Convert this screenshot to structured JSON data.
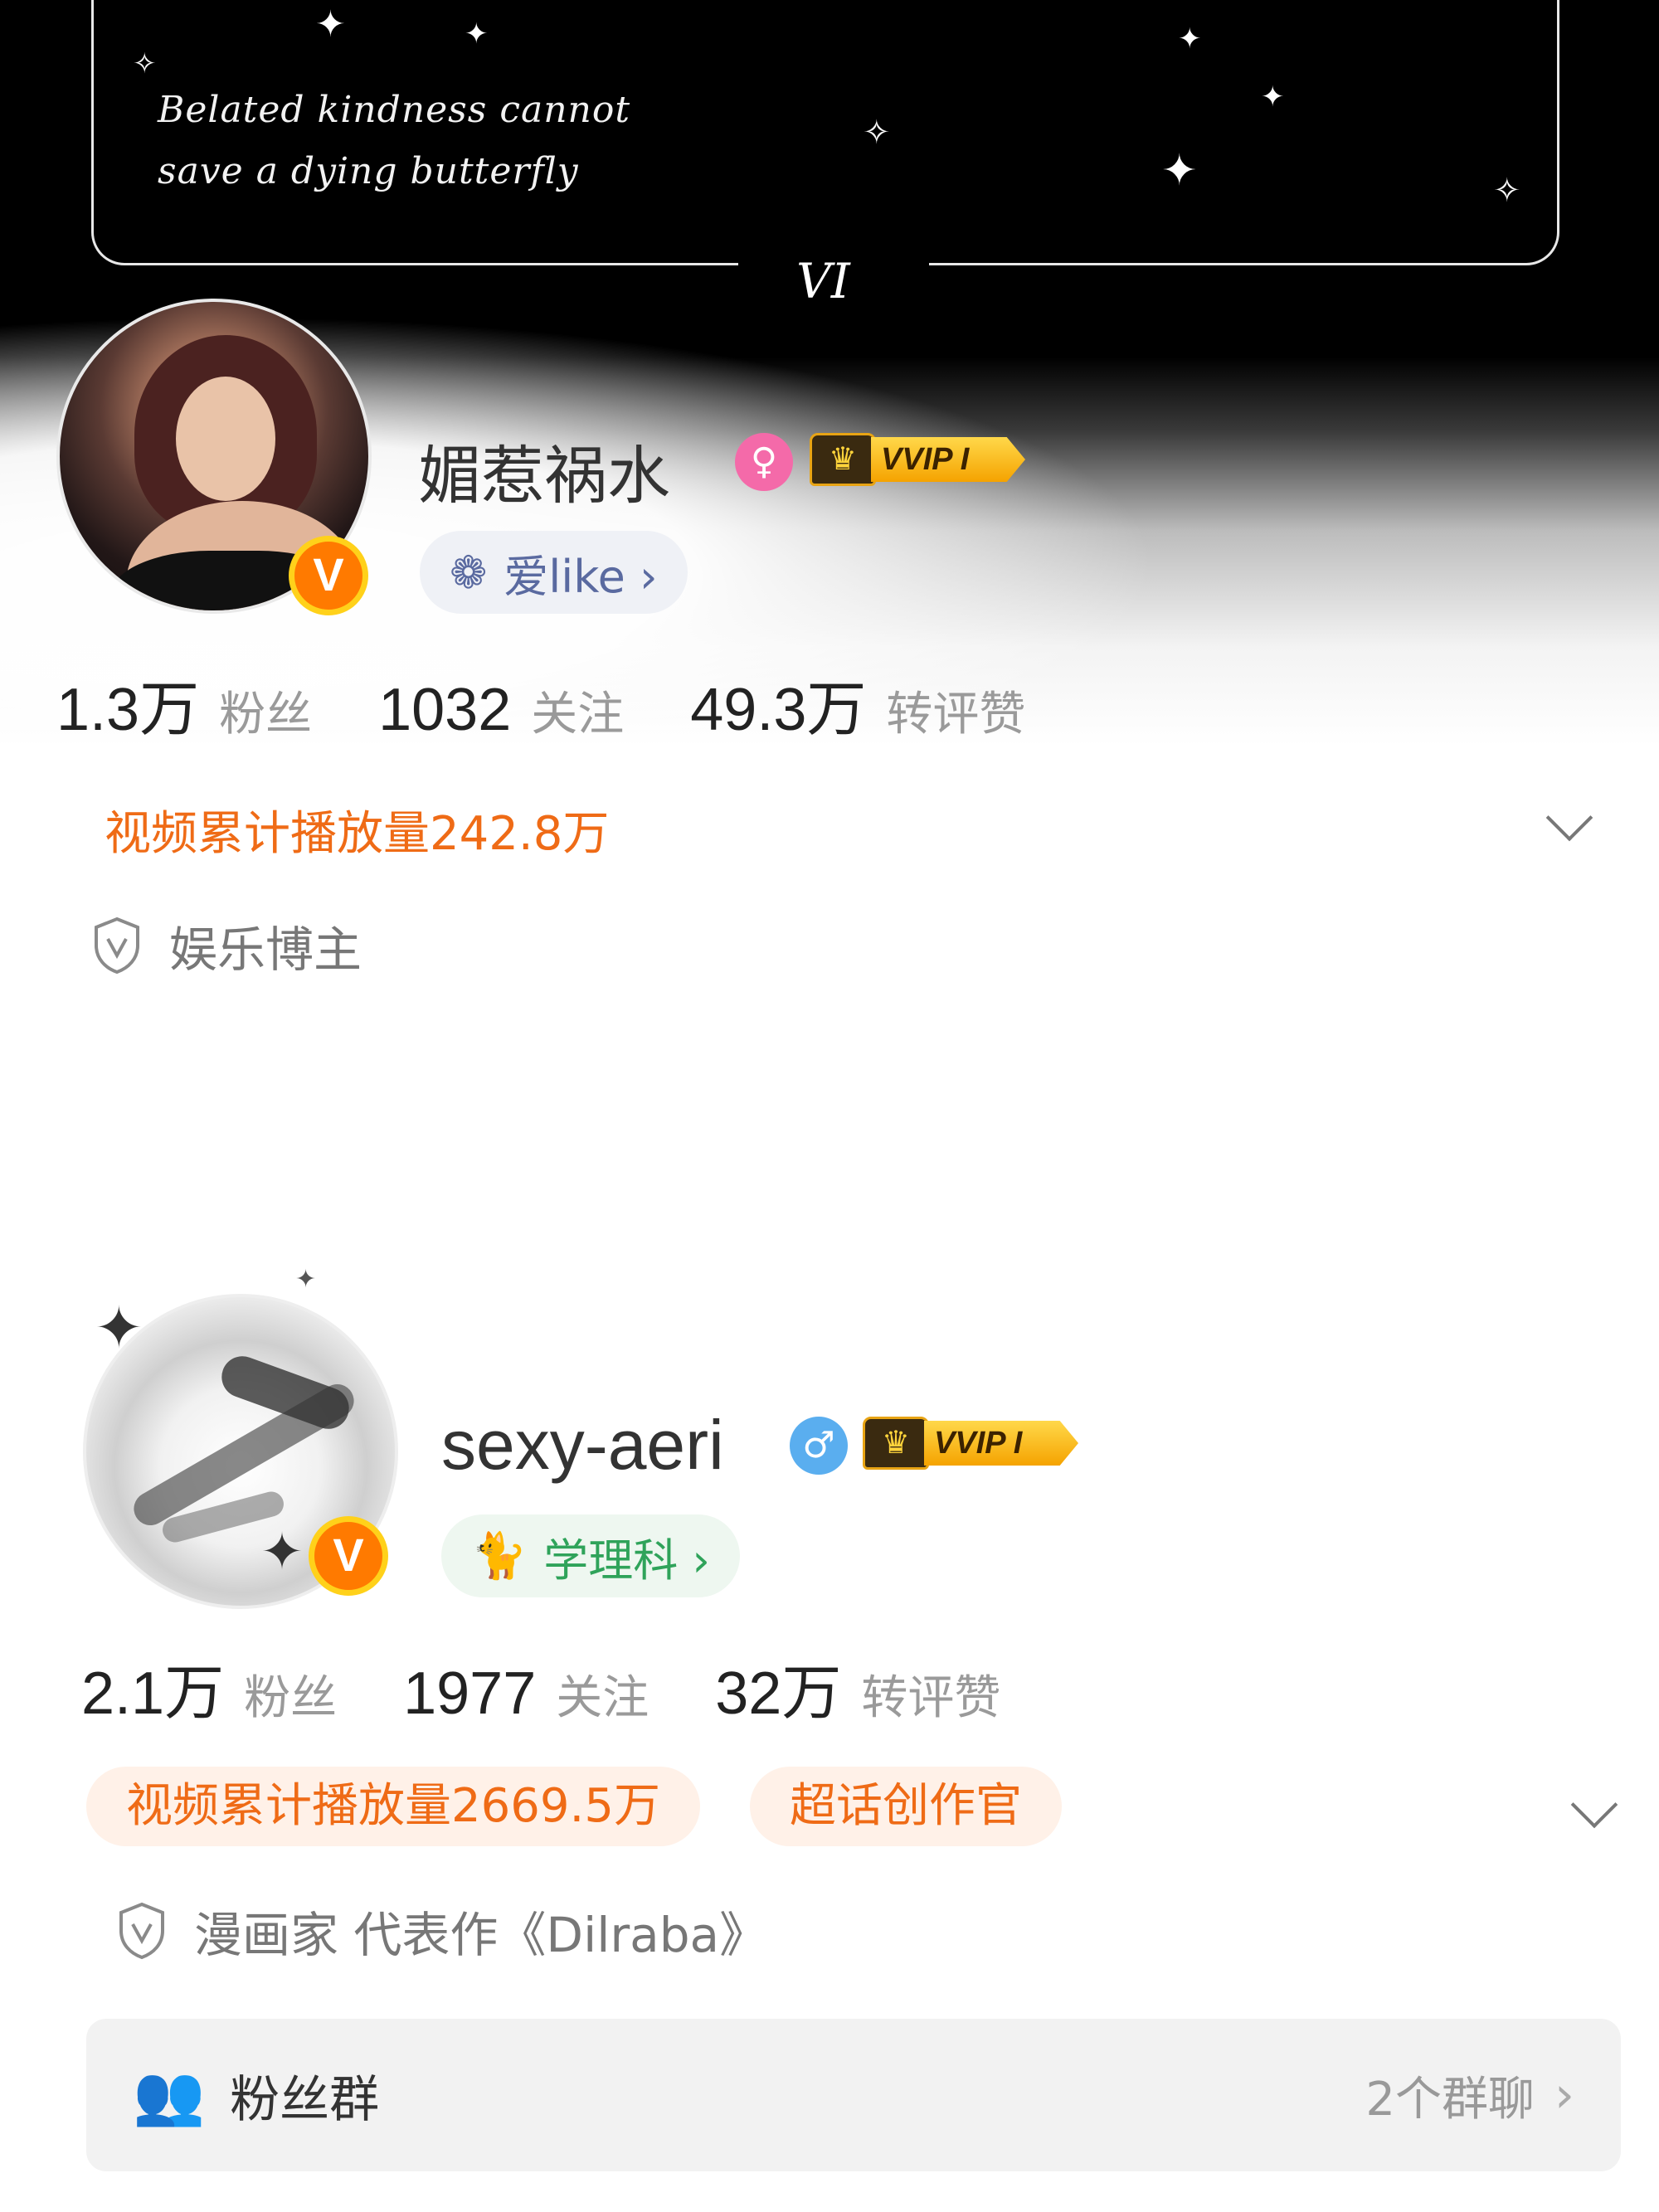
{
  "profile1": {
    "banner": {
      "quote": "Belated kindness cannot save a dying butterfly",
      "mark": "VI"
    },
    "name": "媚惹祸水",
    "gender_icon": "female-icon",
    "vip_label": "VVIP I",
    "tag_label": "爱like ›",
    "stats": [
      {
        "num": "1.3万",
        "label": "粉丝"
      },
      {
        "num": "1032",
        "label": "关注"
      },
      {
        "num": "49.3万",
        "label": "转评赞"
      }
    ],
    "video_plays": "视频累计播放量242.8万",
    "verified": "娱乐博主"
  },
  "profile2": {
    "name": "sexy-aeri",
    "gender_icon": "male-icon",
    "vip_label": "VVIP I",
    "tag_label": "学理科 ›",
    "stats": [
      {
        "num": "2.1万",
        "label": "粉丝"
      },
      {
        "num": "1977",
        "label": "关注"
      },
      {
        "num": "32万",
        "label": "转评赞"
      }
    ],
    "video_plays": "视频累计播放量2669.5万",
    "badge2": "超话创作官",
    "verified": "漫画家 代表作《Dilraba》",
    "fans_group": {
      "title": "粉丝群",
      "count": "2个群聊"
    }
  },
  "colors": {
    "accent_orange": "#ef6b16",
    "vip_gold": "#f5a300",
    "female_pink": "#f46aa9",
    "male_blue": "#5aaeef",
    "tag_green": "#2fa35a"
  }
}
